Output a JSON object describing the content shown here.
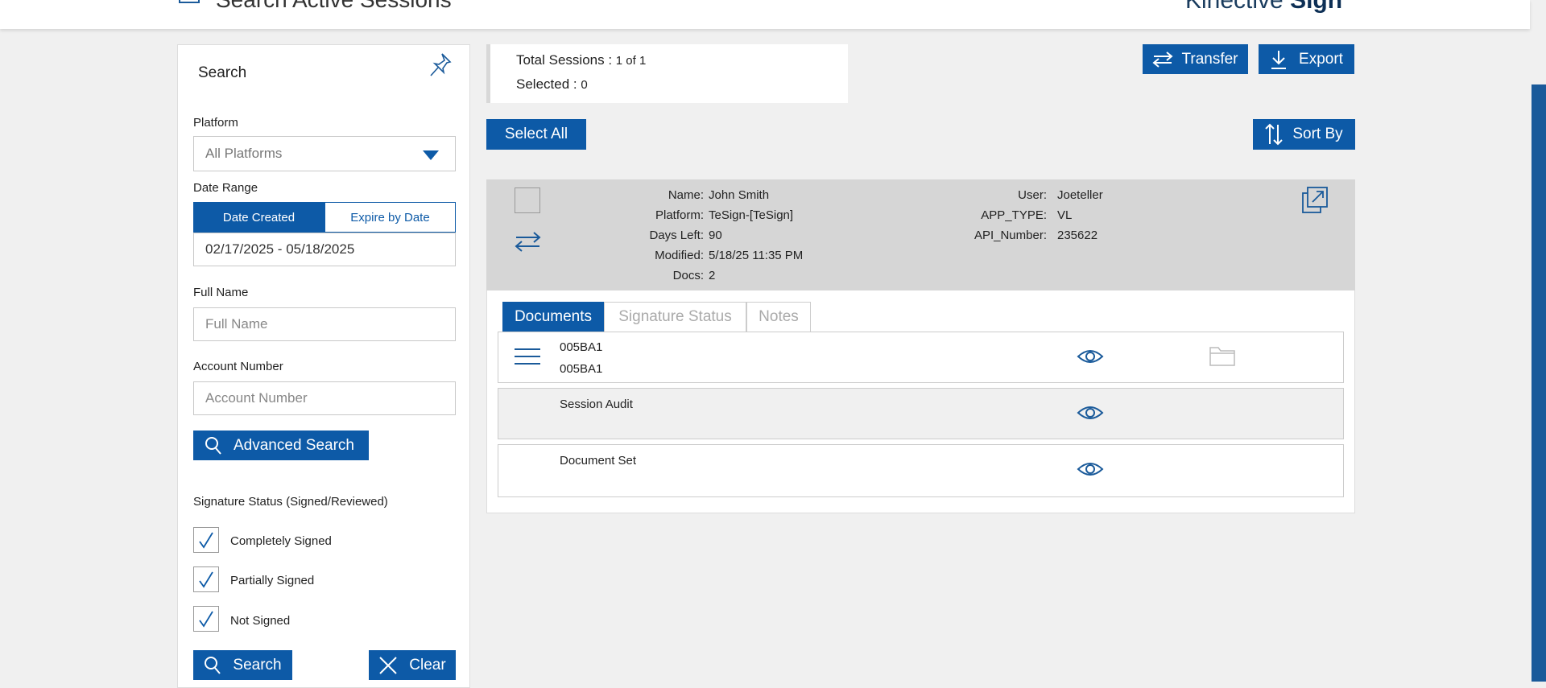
{
  "header": {
    "title": "Search Active Sessions",
    "brand_light": "Kinective ",
    "brand_bold": "Sign"
  },
  "search_panel": {
    "title": "Search",
    "platform_label": "Platform",
    "platform_value": "All Platforms",
    "date_range_label": "Date Range",
    "date_created_label": "Date Created",
    "expire_by_date_label": "Expire by Date",
    "date_range_value": "02/17/2025 - 05/18/2025",
    "full_name_label": "Full Name",
    "full_name_placeholder": "Full Name",
    "account_number_label": "Account Number",
    "account_number_placeholder": "Account Number",
    "advanced_search_label": "Advanced Search",
    "signature_status_label": "Signature Status (Signed/Reviewed)",
    "status_options": [
      {
        "label": "Completely Signed",
        "checked": true
      },
      {
        "label": "Partially Signed",
        "checked": true
      },
      {
        "label": "Not Signed",
        "checked": true
      }
    ],
    "search_button_label": "Search",
    "clear_button_label": "Clear"
  },
  "summary": {
    "total_label": "Total Sessions : ",
    "total_value": "1 of 1",
    "selected_label": "Selected : ",
    "selected_value": "0"
  },
  "toolbar": {
    "transfer_label": "Transfer",
    "export_label": "Export",
    "select_all_label": "Select All",
    "sort_by_label": "Sort By"
  },
  "session": {
    "left_fields": [
      {
        "key": "Name:",
        "value": "John Smith"
      },
      {
        "key": "Platform:",
        "value": "TeSign-[TeSign]"
      },
      {
        "key": "Days Left:",
        "value": "90"
      },
      {
        "key": "Modified:",
        "value": "5/18/25 11:35 PM"
      },
      {
        "key": "Docs:",
        "value": "2"
      }
    ],
    "right_fields": [
      {
        "key": "User:",
        "value": "Joeteller"
      },
      {
        "key": "APP_TYPE:",
        "value": "VL"
      },
      {
        "key": "API_Number:",
        "value": "235622"
      }
    ],
    "tabs": [
      {
        "label": "Documents",
        "active": true
      },
      {
        "label": "Signature Status",
        "active": false
      },
      {
        "label": "Notes",
        "active": false
      }
    ],
    "documents": [
      {
        "line1": "005BA1",
        "line2": "005BA1"
      },
      {
        "line1": "Session Audit",
        "line2": ""
      },
      {
        "line1": "Document Set",
        "line2": ""
      }
    ]
  },
  "colors": {
    "accent": "#0d5aa7",
    "header_bg": "#ffffff",
    "page_bg": "#f0f0f0",
    "session_header_bg": "#d6d6d6"
  }
}
